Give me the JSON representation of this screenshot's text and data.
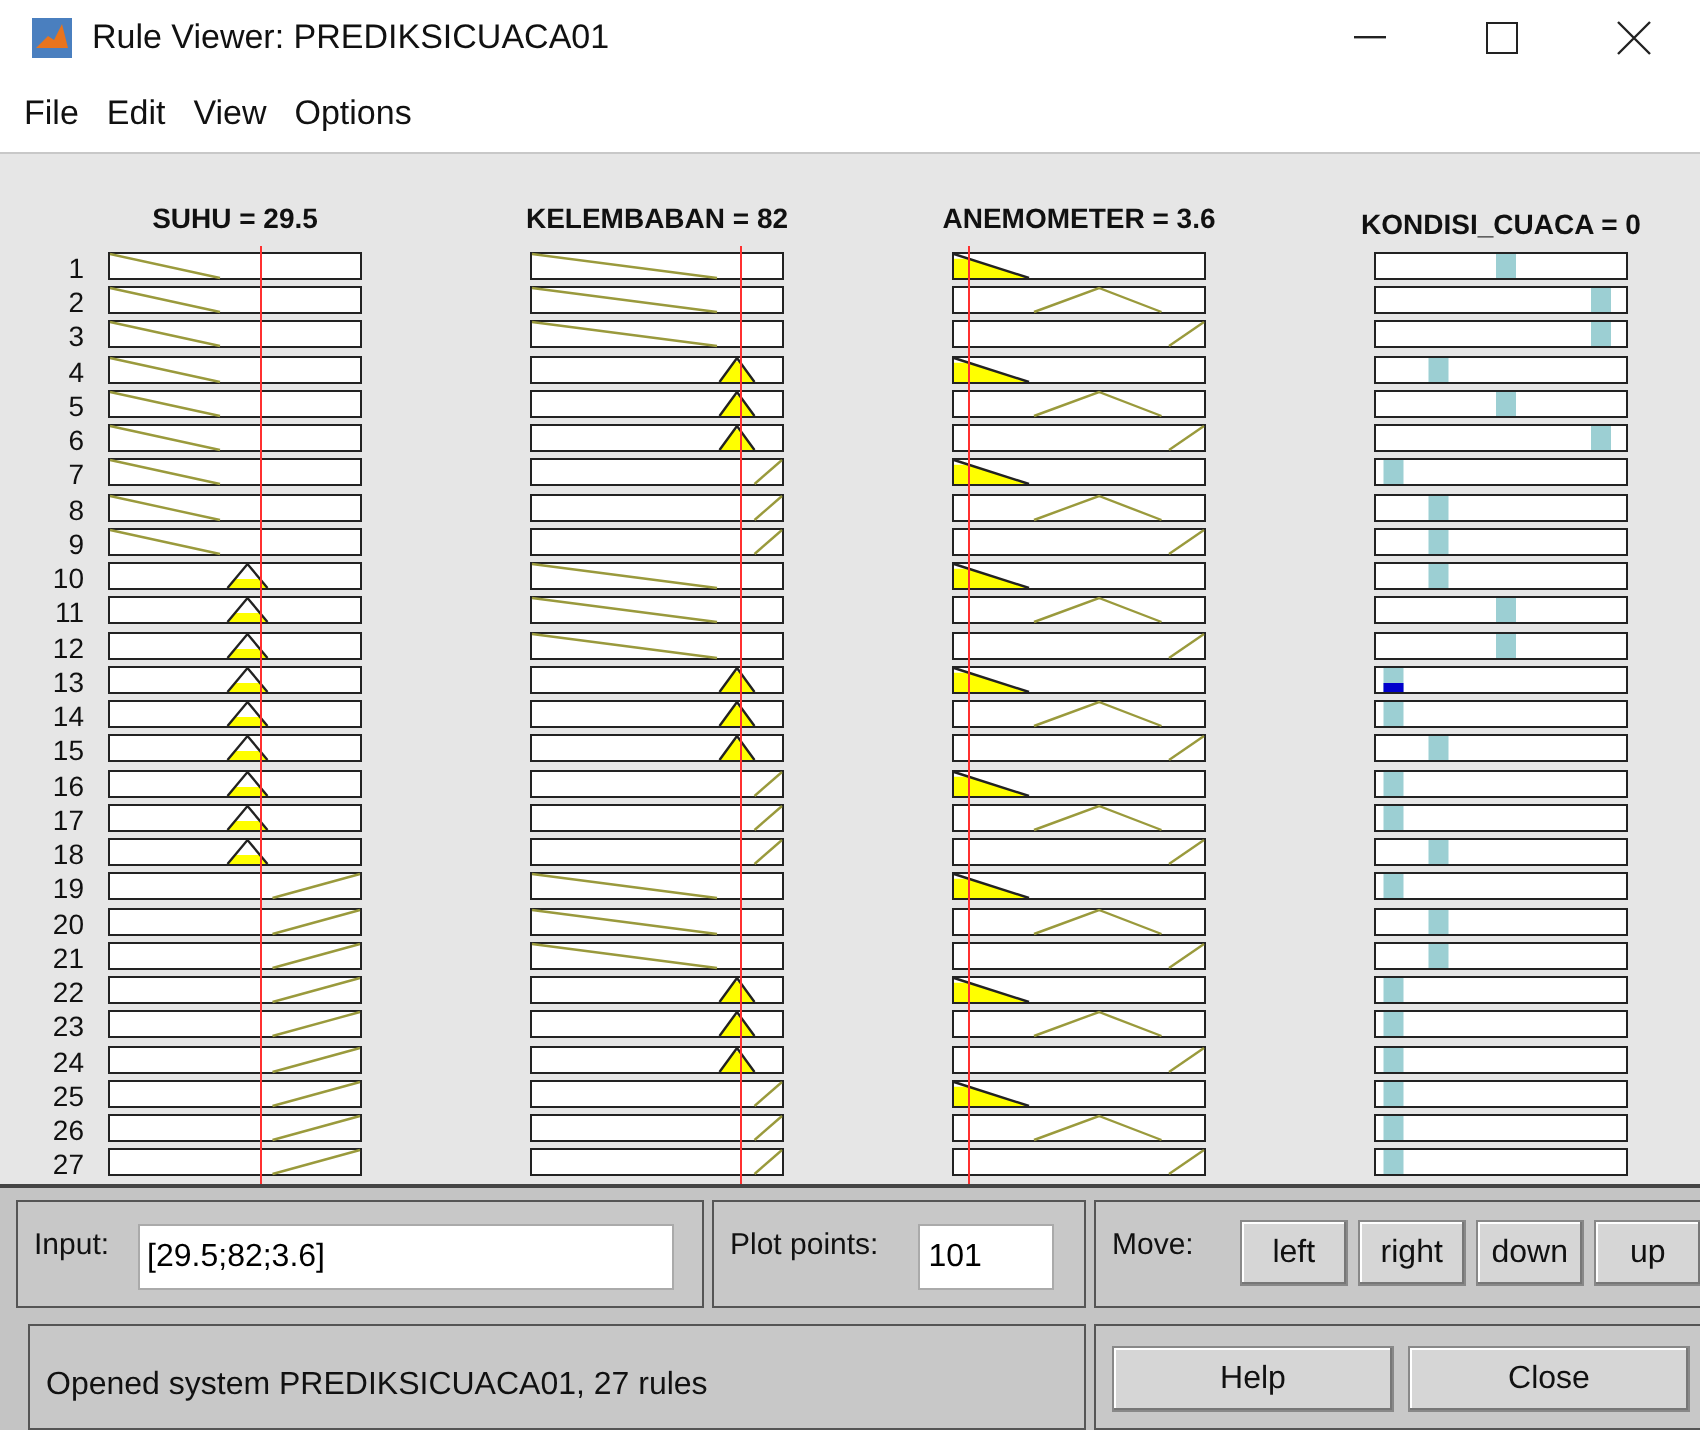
{
  "window": {
    "title": "Rule Viewer: PREDIKSICUACA01"
  },
  "menu": [
    "File",
    "Edit",
    "View",
    "Options"
  ],
  "inputs": [
    {
      "label": "SUHU = 29.5"
    },
    {
      "label": "KELEMBABAN = 82"
    },
    {
      "label": "ANEMOMETER = 3.6"
    }
  ],
  "output": {
    "label": "KONDISI_CUACA = 0"
  },
  "rules": [
    {
      "number": "1",
      "inputs": [
        {
          "kind": "low"
        },
        {
          "kind": "low"
        },
        {
          "kind": "low"
        }
      ],
      "output": {
        "kind": "mid"
      }
    },
    {
      "number": "2",
      "inputs": [
        {
          "kind": "low"
        },
        {
          "kind": "low"
        },
        {
          "kind": "mid"
        }
      ],
      "output": {
        "kind": "high"
      }
    },
    {
      "number": "3",
      "inputs": [
        {
          "kind": "low"
        },
        {
          "kind": "low"
        },
        {
          "kind": "high"
        }
      ],
      "output": {
        "kind": "high"
      }
    },
    {
      "number": "4",
      "inputs": [
        {
          "kind": "low"
        },
        {
          "kind": "mid"
        },
        {
          "kind": "low"
        }
      ],
      "output": {
        "kind": "low"
      }
    },
    {
      "number": "5",
      "inputs": [
        {
          "kind": "low"
        },
        {
          "kind": "mid"
        },
        {
          "kind": "mid"
        }
      ],
      "output": {
        "kind": "mid"
      }
    },
    {
      "number": "6",
      "inputs": [
        {
          "kind": "low"
        },
        {
          "kind": "mid"
        },
        {
          "kind": "high"
        }
      ],
      "output": {
        "kind": "high"
      }
    },
    {
      "number": "7",
      "inputs": [
        {
          "kind": "low"
        },
        {
          "kind": "high"
        },
        {
          "kind": "low"
        }
      ],
      "output": {
        "kind": "lowest"
      }
    },
    {
      "number": "8",
      "inputs": [
        {
          "kind": "low"
        },
        {
          "kind": "high"
        },
        {
          "kind": "mid"
        }
      ],
      "output": {
        "kind": "low"
      }
    },
    {
      "number": "9",
      "inputs": [
        {
          "kind": "low"
        },
        {
          "kind": "high"
        },
        {
          "kind": "high"
        }
      ],
      "output": {
        "kind": "low"
      }
    },
    {
      "number": "10",
      "inputs": [
        {
          "kind": "mid"
        },
        {
          "kind": "low"
        },
        {
          "kind": "low"
        }
      ],
      "output": {
        "kind": "low"
      }
    },
    {
      "number": "11",
      "inputs": [
        {
          "kind": "mid"
        },
        {
          "kind": "low"
        },
        {
          "kind": "mid"
        }
      ],
      "output": {
        "kind": "mid"
      }
    },
    {
      "number": "12",
      "inputs": [
        {
          "kind": "mid"
        },
        {
          "kind": "low"
        },
        {
          "kind": "high"
        }
      ],
      "output": {
        "kind": "mid"
      }
    },
    {
      "number": "13",
      "inputs": [
        {
          "kind": "mid"
        },
        {
          "kind": "mid"
        },
        {
          "kind": "low"
        }
      ],
      "output": {
        "kind": "lowest"
      }
    },
    {
      "number": "14",
      "inputs": [
        {
          "kind": "mid"
        },
        {
          "kind": "mid"
        },
        {
          "kind": "mid"
        }
      ],
      "output": {
        "kind": "lowest"
      }
    },
    {
      "number": "15",
      "inputs": [
        {
          "kind": "mid"
        },
        {
          "kind": "mid"
        },
        {
          "kind": "high"
        }
      ],
      "output": {
        "kind": "low"
      }
    },
    {
      "number": "16",
      "inputs": [
        {
          "kind": "mid"
        },
        {
          "kind": "high"
        },
        {
          "kind": "low"
        }
      ],
      "output": {
        "kind": "lowest"
      }
    },
    {
      "number": "17",
      "inputs": [
        {
          "kind": "mid"
        },
        {
          "kind": "high"
        },
        {
          "kind": "mid"
        }
      ],
      "output": {
        "kind": "lowest"
      }
    },
    {
      "number": "18",
      "inputs": [
        {
          "kind": "mid"
        },
        {
          "kind": "high"
        },
        {
          "kind": "high"
        }
      ],
      "output": {
        "kind": "low"
      }
    },
    {
      "number": "19",
      "inputs": [
        {
          "kind": "high"
        },
        {
          "kind": "low"
        },
        {
          "kind": "low"
        }
      ],
      "output": {
        "kind": "lowest"
      }
    },
    {
      "number": "20",
      "inputs": [
        {
          "kind": "high"
        },
        {
          "kind": "low"
        },
        {
          "kind": "mid"
        }
      ],
      "output": {
        "kind": "low"
      }
    },
    {
      "number": "21",
      "inputs": [
        {
          "kind": "high"
        },
        {
          "kind": "low"
        },
        {
          "kind": "high"
        }
      ],
      "output": {
        "kind": "low"
      }
    },
    {
      "number": "22",
      "inputs": [
        {
          "kind": "high"
        },
        {
          "kind": "mid"
        },
        {
          "kind": "low"
        }
      ],
      "output": {
        "kind": "lowest"
      }
    },
    {
      "number": "23",
      "inputs": [
        {
          "kind": "high"
        },
        {
          "kind": "mid"
        },
        {
          "kind": "mid"
        }
      ],
      "output": {
        "kind": "lowest"
      }
    },
    {
      "number": "24",
      "inputs": [
        {
          "kind": "high"
        },
        {
          "kind": "mid"
        },
        {
          "kind": "high"
        }
      ],
      "output": {
        "kind": "lowest"
      }
    },
    {
      "number": "25",
      "inputs": [
        {
          "kind": "high"
        },
        {
          "kind": "high"
        },
        {
          "kind": "low"
        }
      ],
      "output": {
        "kind": "lowest"
      }
    },
    {
      "number": "26",
      "inputs": [
        {
          "kind": "high"
        },
        {
          "kind": "high"
        },
        {
          "kind": "mid"
        }
      ],
      "output": {
        "kind": "lowest"
      }
    },
    {
      "number": "27",
      "inputs": [
        {
          "kind": "high"
        },
        {
          "kind": "high"
        },
        {
          "kind": "high"
        }
      ],
      "output": {
        "kind": "lowest"
      }
    }
  ],
  "input_field": {
    "label": "Input:",
    "value": "[29.5;82;3.6]"
  },
  "plot_points": {
    "label": "Plot points:",
    "value": "101"
  },
  "move": {
    "label": "Move:",
    "buttons": [
      "left",
      "right",
      "down",
      "up"
    ]
  },
  "status": "Opened system PREDIKSICUACA01, 27 rules",
  "buttons": [
    "Help",
    "Close"
  ]
}
